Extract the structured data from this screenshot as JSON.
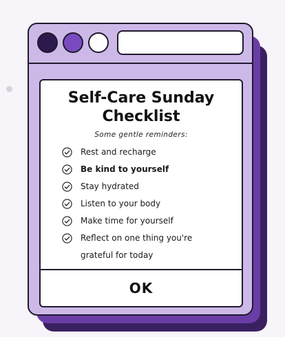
{
  "window": {
    "controls": [
      "dark-purple-circle",
      "purple-circle",
      "white-circle"
    ],
    "title_field_value": ""
  },
  "card": {
    "title_line1": "Self-Care Sunday",
    "title_line2": "Checklist",
    "subtitle": "Some gentle reminders:",
    "items": [
      {
        "label": "Rest and recharge",
        "checked": true
      },
      {
        "label": "Be kind to yourself",
        "checked": true
      },
      {
        "label": "Stay hydrated",
        "checked": true
      },
      {
        "label": "Listen to your body",
        "checked": true
      },
      {
        "label": "Make time for yourself",
        "checked": true
      },
      {
        "label": "Reflect on one thing you're grateful for today",
        "checked": true
      }
    ],
    "ok_label": "OK"
  },
  "colors": {
    "page_background": "#f7f5f9",
    "window_fill": "#ccb9e8",
    "shadow_mid": "#6a3da6",
    "shadow_dark": "#3a2060",
    "control_dark": "#2c1a4e",
    "control_purple": "#7a4bbf",
    "outline": "#201a2e"
  }
}
